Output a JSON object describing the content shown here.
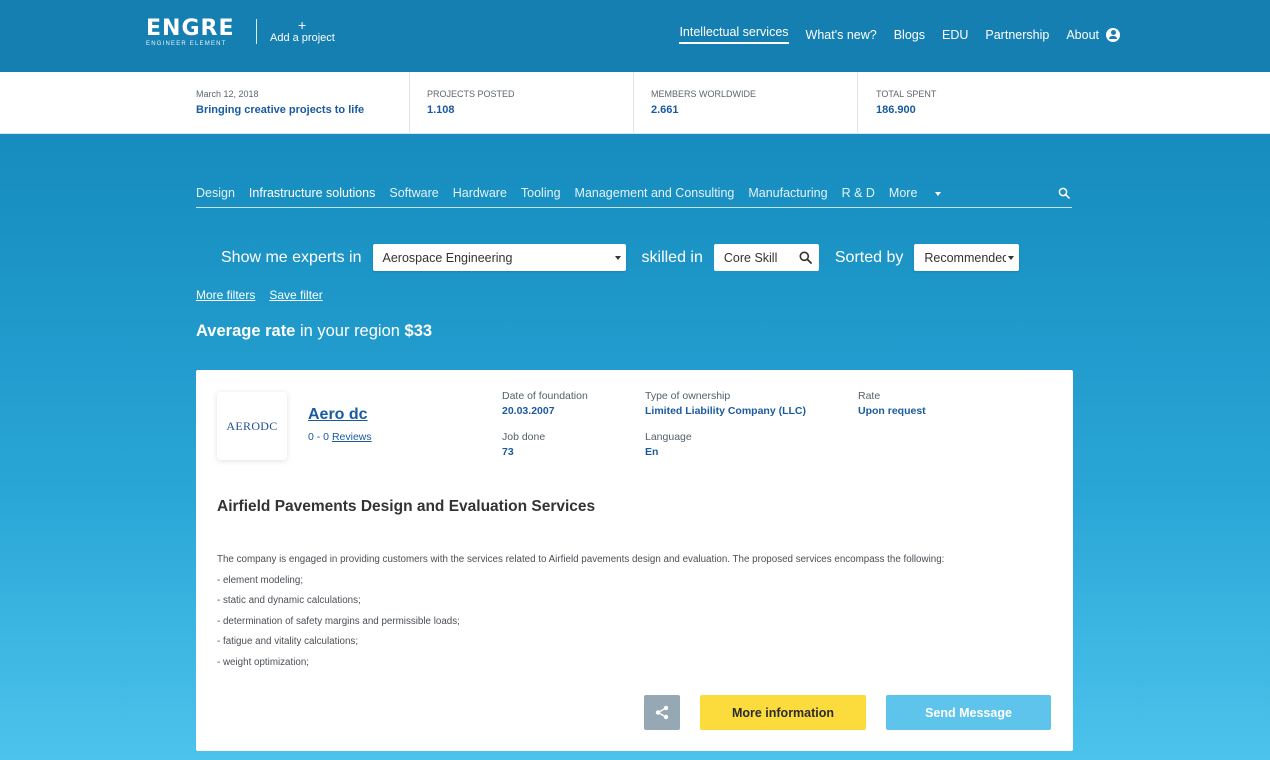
{
  "header": {
    "logo_main": "ENGRE",
    "logo_sub": "ENGINEER ELEMENT",
    "add_project_plus": "+",
    "add_project_label": "Add a project",
    "nav": [
      "Intellectual services",
      "What's new?",
      "Blogs",
      "EDU",
      "Partnership",
      "About"
    ],
    "user_icon": "user-circle-icon"
  },
  "stats": [
    {
      "label": "March 12, 2018",
      "value": "Bringing creative projects to life"
    },
    {
      "label": "PROJECTS POSTED",
      "value": "1.108"
    },
    {
      "label": "MEMBERS WORLDWIDE",
      "value": "2.661"
    },
    {
      "label": "TOTAL SPENT",
      "value": "186.900"
    }
  ],
  "categories": [
    "Design",
    "Infrastructure solutions",
    "Software",
    "Hardware",
    "Tooling",
    "Management and Consulting",
    "Manufacturing",
    "R & D"
  ],
  "categories_more": "More",
  "filter": {
    "show_me": "Show me experts in",
    "field": "Aerospace Engineering",
    "skilled_in": "skilled in",
    "skill_placeholder": "Core Skill",
    "sorted_by": "Sorted by",
    "sort_value": "Recommended"
  },
  "links": {
    "more_filters": "More filters",
    "save_filter": "Save filter"
  },
  "average": {
    "bold": "Average rate",
    "middle": " in your region ",
    "amount": "$33"
  },
  "card": {
    "logo_text": "AERODC",
    "company_name": "Aero dc",
    "rating": "0 - 0 ",
    "reviews_label": "Reviews",
    "meta": {
      "foundation_label": "Date of foundation",
      "foundation_value": "20.03.2007",
      "ownership_label": "Type of ownership",
      "ownership_value": "Limited Liability Company (LLC)",
      "rate_label": "Rate",
      "rate_value": "Upon request",
      "job_label": "Job done",
      "job_value": "73",
      "language_label": "Language",
      "language_value": "En"
    },
    "service_title": "Airfield Pavements Design and Evaluation Services",
    "description": [
      "The company is engaged in providing customers with the services related to Airfield pavements design and evaluation. The proposed services encompass the following:",
      "- element modeling;",
      "- static and dynamic calculations;",
      "- determination of safety margins and permissible loads;",
      "- fatigue and vitality calculations;",
      "- weight optimization;"
    ],
    "more_info": "More information",
    "send_message": "Send Message",
    "share_icon": "share-icon"
  },
  "colors": {
    "header_bg": "#157fb1",
    "accent_blue": "#1a5a9e",
    "more_info_bg": "#fbdc3c",
    "send_bg": "#5ec4ec",
    "share_bg": "#97a8b5"
  }
}
